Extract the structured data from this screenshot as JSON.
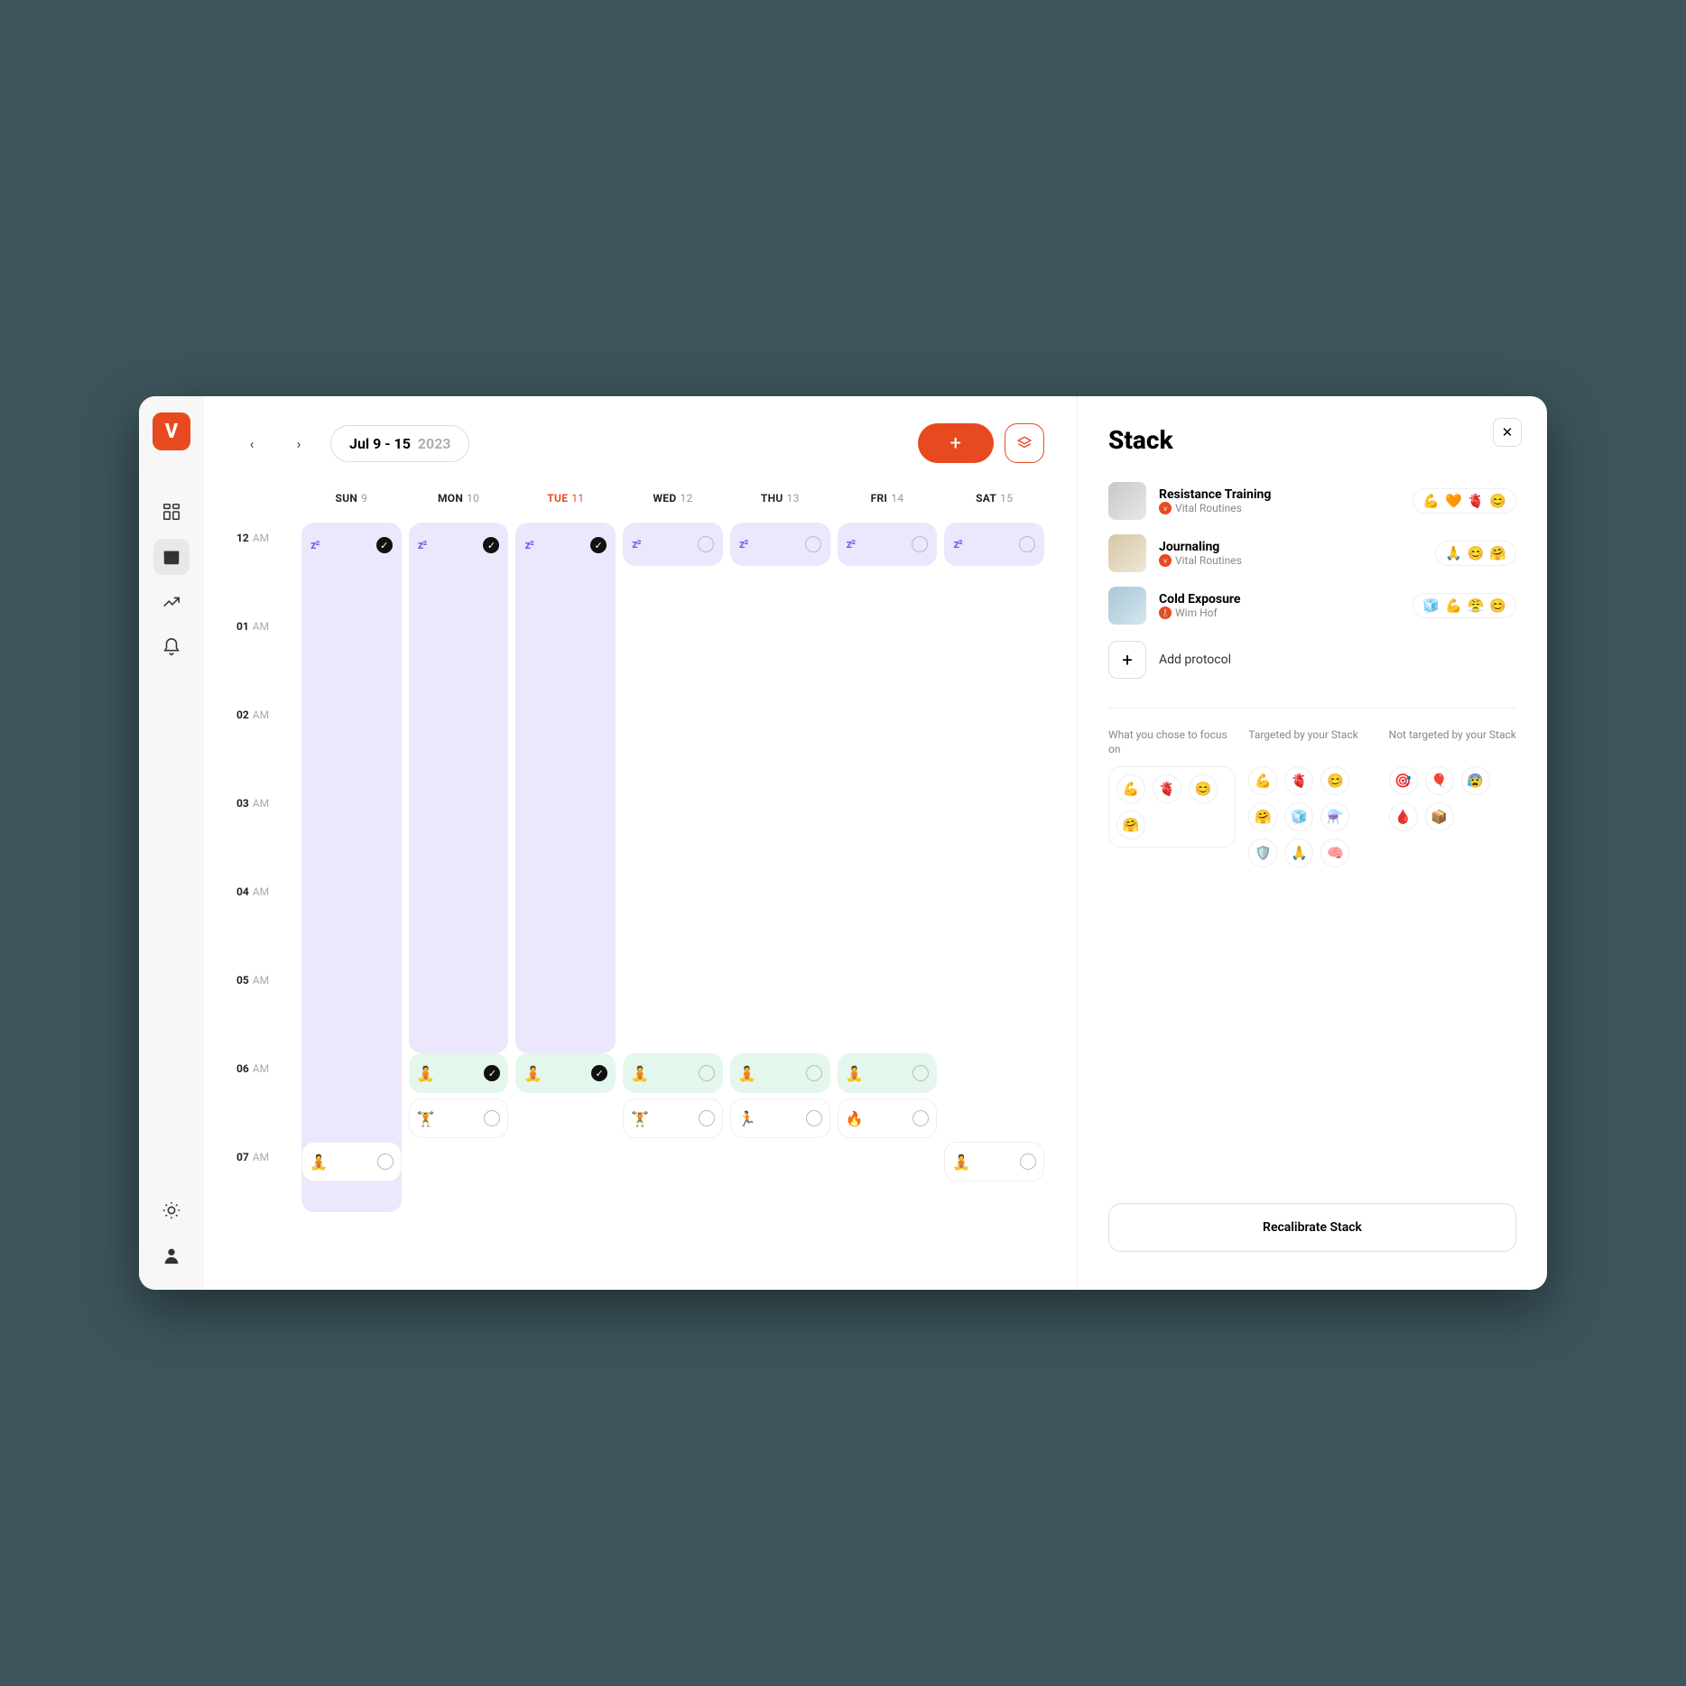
{
  "dateRange": {
    "main": "Jul 9 - 15",
    "year": "2023"
  },
  "days": [
    {
      "name": "SUN",
      "num": "9",
      "today": false
    },
    {
      "name": "MON",
      "num": "10",
      "today": false
    },
    {
      "name": "TUE",
      "num": "11",
      "today": true
    },
    {
      "name": "WED",
      "num": "12",
      "today": false
    },
    {
      "name": "THU",
      "num": "13",
      "today": false
    },
    {
      "name": "FRI",
      "num": "14",
      "today": false
    },
    {
      "name": "SAT",
      "num": "15",
      "today": false
    }
  ],
  "hours": [
    {
      "h": "12",
      "ampm": "AM"
    },
    {
      "h": "01",
      "ampm": "AM"
    },
    {
      "h": "02",
      "ampm": "AM"
    },
    {
      "h": "03",
      "ampm": "AM"
    },
    {
      "h": "04",
      "ampm": "AM"
    },
    {
      "h": "05",
      "ampm": "AM"
    },
    {
      "h": "06",
      "ampm": "AM"
    },
    {
      "h": "07",
      "ampm": "AM"
    }
  ],
  "sleepBlocks": [
    {
      "day": 0,
      "done": true,
      "long": true
    },
    {
      "day": 1,
      "done": true,
      "long": false
    },
    {
      "day": 2,
      "done": true,
      "long": false
    },
    {
      "day": 3,
      "done": false,
      "long": false,
      "short": true
    },
    {
      "day": 4,
      "done": false,
      "long": false,
      "short": true
    },
    {
      "day": 5,
      "done": false,
      "long": false,
      "short": true
    },
    {
      "day": 6,
      "done": false,
      "long": false,
      "short": true
    }
  ],
  "morningEvents": {
    "0": [],
    "1": [
      {
        "emoji": "🧘",
        "cls": "meditate",
        "done": true
      },
      {
        "emoji": "🏋️",
        "cls": "",
        "done": false
      }
    ],
    "2": [
      {
        "emoji": "🧘",
        "cls": "meditate",
        "done": true
      }
    ],
    "3": [
      {
        "emoji": "🧘",
        "cls": "meditate",
        "done": false
      },
      {
        "emoji": "🏋️",
        "cls": "",
        "done": false
      }
    ],
    "4": [
      {
        "emoji": "🧘",
        "cls": "meditate",
        "done": false
      },
      {
        "emoji": "🏃",
        "cls": "",
        "done": false
      }
    ],
    "5": [
      {
        "emoji": "🧘",
        "cls": "meditate",
        "done": false
      },
      {
        "emoji": "🔥",
        "cls": "",
        "done": false
      }
    ],
    "6": []
  },
  "sevenAm": {
    "0": {
      "emoji": "🧘",
      "cls": "",
      "done": false
    },
    "6": {
      "emoji": "🧘",
      "cls": "",
      "done": false
    }
  },
  "panel": {
    "title": "Stack",
    "protocols": [
      {
        "title": "Resistance Training",
        "source": "Vital Routines",
        "badge": "v",
        "emojis": [
          "💪",
          "🧡",
          "🫀",
          "😊"
        ],
        "thumb": "t1"
      },
      {
        "title": "Journaling",
        "source": "Vital Routines",
        "badge": "v",
        "emojis": [
          "🙏",
          "😊",
          "🤗"
        ],
        "thumb": "t2"
      },
      {
        "title": "Cold Exposure",
        "source": "Wim Hof",
        "badge": "🌡️",
        "emojis": [
          "🧊",
          "💪",
          "😤",
          "😊"
        ],
        "thumb": "t3"
      }
    ],
    "addLabel": "Add protocol",
    "focusCols": [
      {
        "title": "What you chose to focus on",
        "chips": [
          "💪",
          "🫀",
          "😊",
          "🤗"
        ]
      },
      {
        "title": "Targeted by your Stack",
        "chips": [
          "💪",
          "🫀",
          "😊",
          "🤗",
          "🧊",
          "⚗️",
          "🛡️",
          "🙏",
          "🧠"
        ]
      },
      {
        "title": "Not targeted by your Stack",
        "chips": [
          "🎯",
          "🎈",
          "😰",
          "🩸",
          "📦"
        ]
      }
    ],
    "recalibrate": "Recalibrate Stack"
  }
}
